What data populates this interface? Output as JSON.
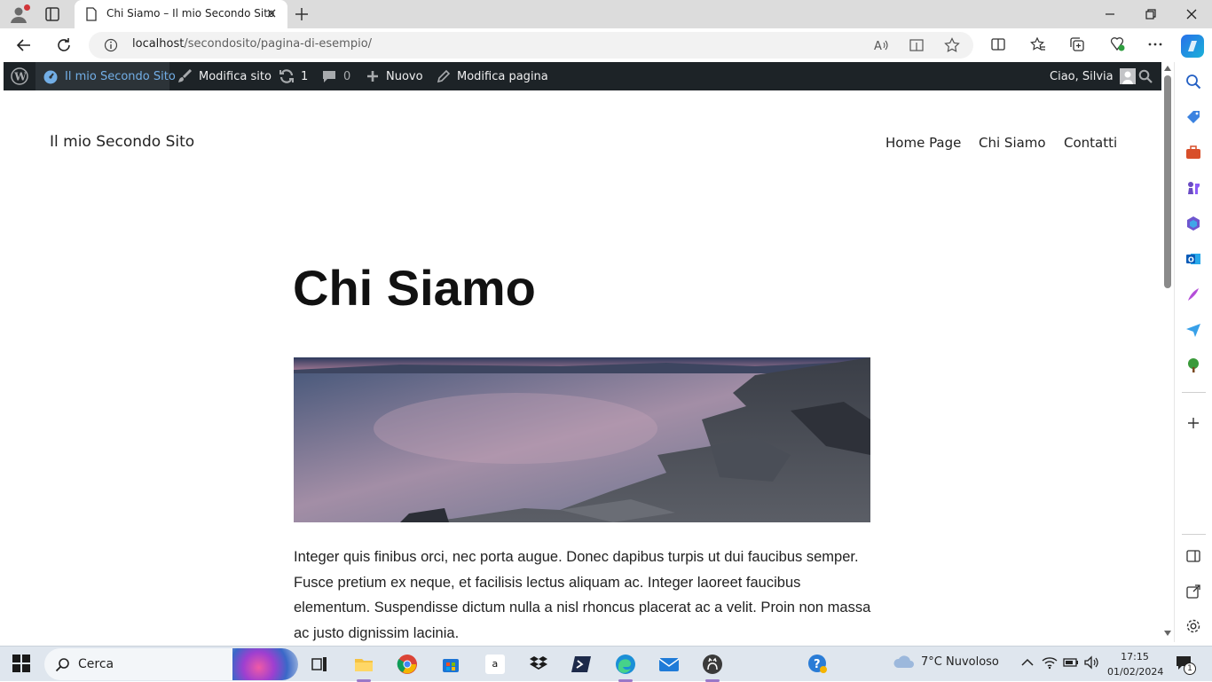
{
  "browser": {
    "tab": {
      "title": "Chi Siamo – Il mio Secondo Sito"
    },
    "address": {
      "host": "localhost",
      "path": "/secondosito/pagina-di-esempio/"
    }
  },
  "admin_bar": {
    "site_name": "Il mio Secondo Sito",
    "edit_site": "Modifica sito",
    "updates_count": "1",
    "comments_count": "0",
    "new_label": "Nuovo",
    "edit_page": "Modifica pagina",
    "greeting": "Ciao, Silvia"
  },
  "site": {
    "title": "Il mio Secondo Sito",
    "menu": [
      "Home Page",
      "Chi Siamo",
      "Contatti"
    ]
  },
  "page": {
    "title": "Chi Siamo",
    "paragraph": "Integer quis finibus orci, nec porta augue. Donec dapibus turpis ut dui faucibus semper. Fusce pretium ex neque, et facilisis lectus aliquam ac. Integer laoreet faucibus elementum. Suspendisse dictum nulla a nisl rhoncus placerat ac a velit. Proin non massa ac justo dignissim lacinia."
  },
  "taskbar": {
    "search_label": "Cerca",
    "weather": "7°C  Nuvoloso",
    "time": "17:15",
    "date": "01/02/2024",
    "notification_count": "1",
    "amazon_letter": "a"
  }
}
